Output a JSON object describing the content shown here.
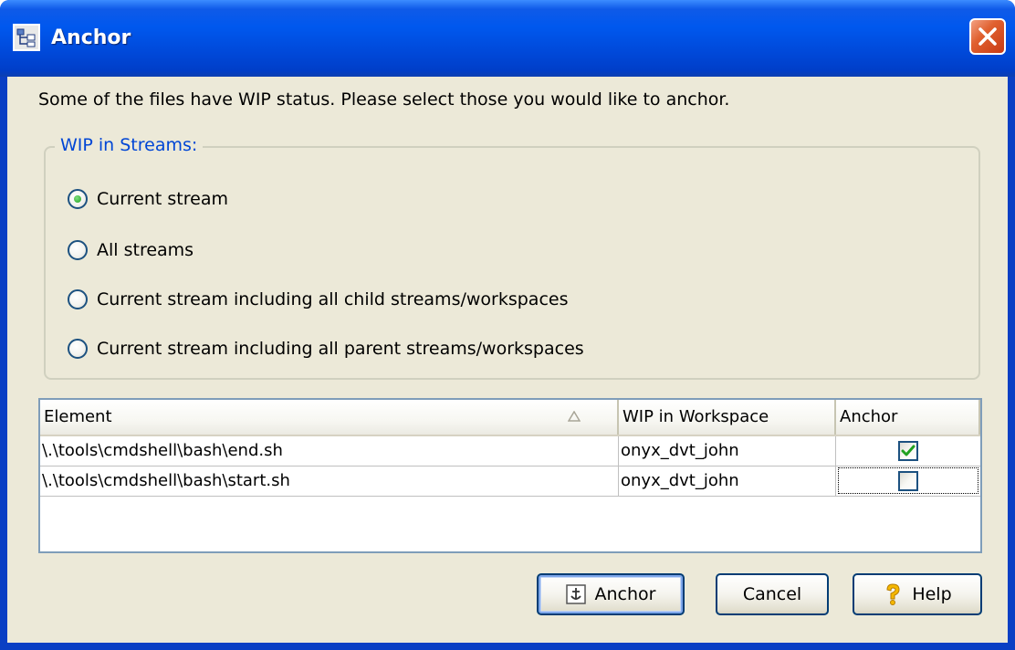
{
  "window": {
    "title": "Anchor",
    "close_icon": "close-icon",
    "app_icon": "anchor-dialog-icon"
  },
  "message": "Some of the files have WIP status. Please select those you would like to anchor.",
  "wip_group": {
    "title": "WIP in Streams:",
    "options": [
      {
        "label": "Current stream",
        "checked": true
      },
      {
        "label": "All streams",
        "checked": false
      },
      {
        "label": "Current stream including all child streams/workspaces",
        "checked": false
      },
      {
        "label": "Current stream including all parent streams/workspaces",
        "checked": false
      }
    ]
  },
  "table": {
    "columns": [
      "Element",
      "WIP in Workspace",
      "Anchor"
    ],
    "sort_column": "Element",
    "sort_icon": "sort-ascending-icon",
    "rows": [
      {
        "element": "\\.\\tools\\cmdshell\\bash\\end.sh",
        "workspace": "onyx_dvt_john",
        "anchor": true
      },
      {
        "element": "\\.\\tools\\cmdshell\\bash\\start.sh",
        "workspace": "onyx_dvt_john",
        "anchor": false
      }
    ]
  },
  "buttons": {
    "anchor": "Anchor",
    "cancel": "Cancel",
    "help": "Help",
    "anchor_icon": "anchor-icon",
    "help_icon": "help-icon"
  },
  "colors": {
    "title_bar": "#0058ee",
    "dialog_bg": "#ece9d8",
    "group_title": "#0046d5",
    "close_button": "#e0602f"
  }
}
